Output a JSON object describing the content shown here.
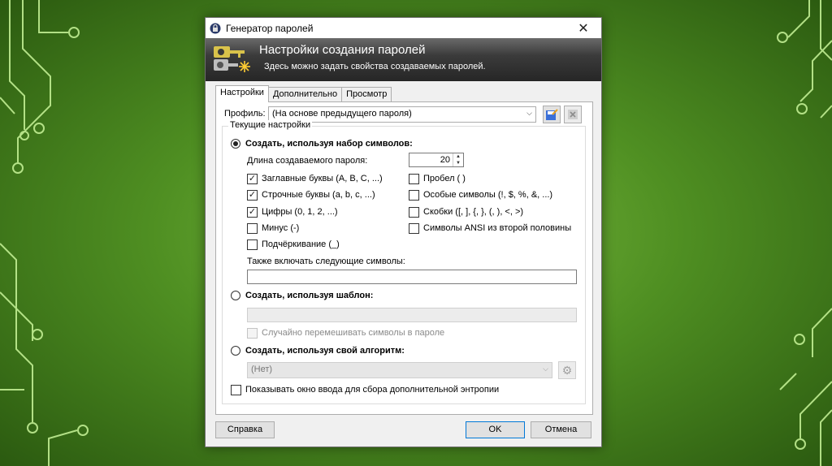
{
  "dialog": {
    "title": "Генератор паролей",
    "close_icon": "close-icon",
    "banner_title": "Настройки создания паролей",
    "banner_subtitle": "Здесь можно задать свойства создаваемых паролей."
  },
  "tabs": [
    {
      "label": "Настройки",
      "active": true
    },
    {
      "label": "Дополнительно",
      "active": false
    },
    {
      "label": "Просмотр",
      "active": false
    }
  ],
  "profile": {
    "label": "Профиль:",
    "value": "(На основе предыдущего пароля)"
  },
  "current_settings": {
    "legend": "Текущие настройки",
    "charset_radio": {
      "label": "Создать, используя набор символов:",
      "checked": true
    },
    "length_label": "Длина создаваемого пароля:",
    "length_value": "20",
    "left_options": [
      {
        "label": "Заглавные буквы (A, B, C, ...)",
        "checked": true
      },
      {
        "label": "Строчные буквы (a, b, c, ...)",
        "checked": true
      },
      {
        "label": "Цифры (0, 1, 2, ...)",
        "checked": true
      },
      {
        "label": "Минус (-)",
        "checked": false
      },
      {
        "label": "Подчёркивание (_)",
        "checked": false
      }
    ],
    "right_options": [
      {
        "label": "Пробел ( )",
        "checked": false
      },
      {
        "label": "Особые символы (!, $, %, &, ...)",
        "checked": false
      },
      {
        "label": "Скобки ([, ], {, }, (, ), <, >)",
        "checked": false
      },
      {
        "label": "Символы ANSI из второй половины",
        "checked": false
      }
    ],
    "extra_label": "Также включать следующие символы:",
    "extra_value": "",
    "pattern_radio": {
      "label": "Создать, используя шаблон:",
      "checked": false
    },
    "pattern_value": "",
    "shuffle_label": "Случайно перемешивать символы в пароле",
    "algorithm_radio": {
      "label": "Создать, используя свой алгоритм:",
      "checked": false
    },
    "algorithm_value": "(Нет)",
    "entropy_label": "Показывать окно ввода для сбора дополнительной энтропии"
  },
  "buttons": {
    "help": "Справка",
    "ok": "OK",
    "cancel": "Отмена"
  },
  "colors": {
    "background": "#4f8f22",
    "banner": "#2e2e2e",
    "accent": "#0078d7"
  }
}
